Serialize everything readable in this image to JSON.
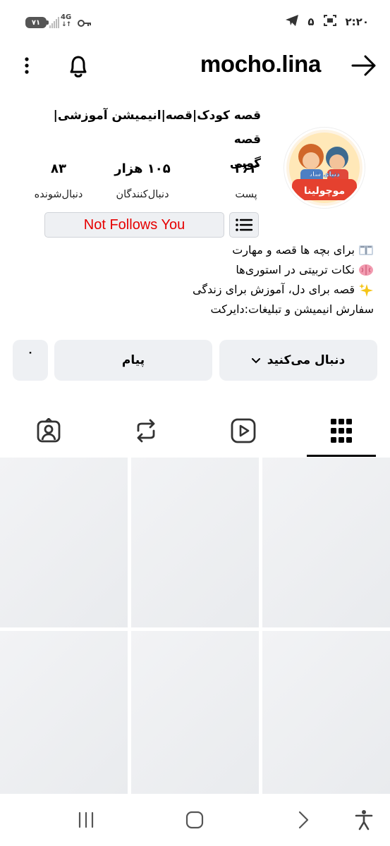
{
  "status_bar": {
    "battery": "۷۱",
    "network": "4G",
    "network_arrows": "↓↑",
    "notification_count": "۵",
    "time": "۲:۲۰"
  },
  "header": {
    "username": "mocho.lina"
  },
  "profile": {
    "avatar_caption_top": "دنیای شاد",
    "avatar_caption_bottom": "موچولینا",
    "name_line1": "قصه کودک|قصه|انیمیشن آموزشی|قصه",
    "name_line2": "گویی",
    "stats": {
      "posts_count": "۲۶۲",
      "posts_label": "پست",
      "followers_count": "۱۰۵ هزار",
      "followers_label": "دنبال‌کنندگان",
      "following_count": "۸۳",
      "following_label": "دنبال‌شونده"
    },
    "not_follows_badge": "Not Follows You",
    "bio": [
      "برای بچه ها قصه و مهارت",
      "نکات تربیتی در استوری‌ها",
      "قصه برای دل، آموزش برای زندگی",
      "سفارش انیمیشن و تبلیغات:دایرکت"
    ]
  },
  "actions": {
    "follow_label": "دنبال می‌کنید",
    "message_label": "پیام",
    "more_label": "۰"
  },
  "tabs": [
    "tagged-icon",
    "repost-icon",
    "reels-icon",
    "grid-icon"
  ],
  "colors": {
    "not_follows_text": "#e60000",
    "button_bg": "#eef0f3",
    "accent_black": "#000000"
  }
}
